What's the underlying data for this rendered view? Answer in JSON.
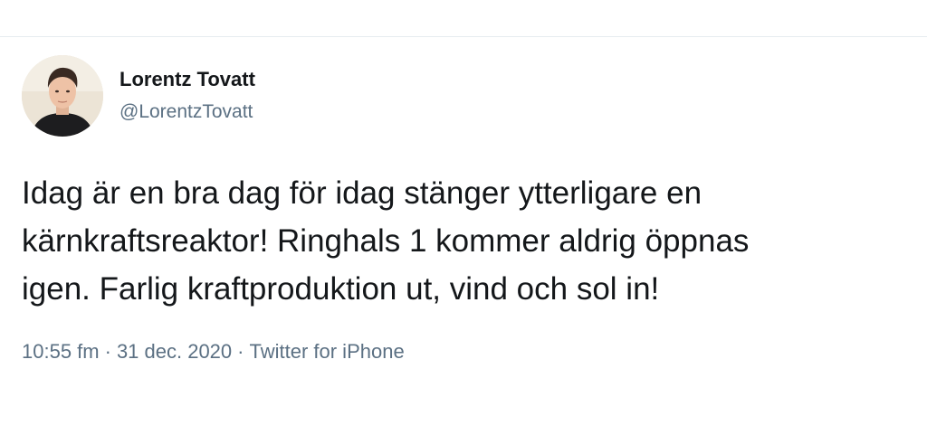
{
  "tweet": {
    "author": {
      "name": "Lorentz Tovatt",
      "handle": "@LorentzTovatt"
    },
    "text_lines": [
      "Idag är en bra dag för idag stänger ytterligare en",
      "kärnkraftsreaktor! Ringhals 1 kommer aldrig öppnas",
      "igen. Farlig kraftproduktion ut, vind och sol in!"
    ],
    "time": "10:55 fm",
    "separator": "·",
    "date": "31 dec. 2020",
    "source": "Twitter for iPhone"
  },
  "colors": {
    "text": "#14171a",
    "secondary": "#5b7083",
    "divider": "#e6ecf0"
  }
}
